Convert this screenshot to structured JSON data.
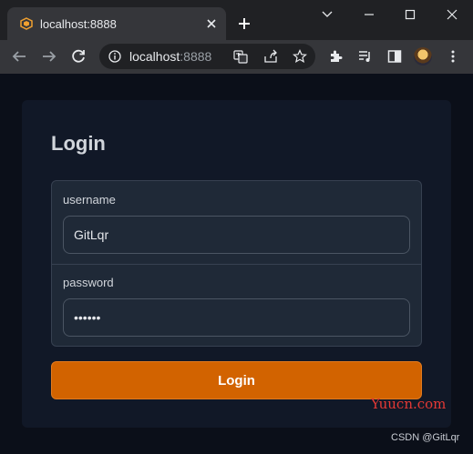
{
  "browser": {
    "tab": {
      "title": "localhost:8888"
    },
    "omnibox": {
      "host": "localhost",
      "port": ":8888"
    }
  },
  "login": {
    "title": "Login",
    "username_label": "username",
    "username_value": "GitLqr",
    "password_label": "password",
    "password_value": "••••••",
    "submit_label": "Login"
  },
  "watermarks": {
    "site": "Yuucn.com",
    "author": "CSDN @GitLqr"
  },
  "colors": {
    "accent": "#d26300",
    "watermark": "#e53935"
  }
}
